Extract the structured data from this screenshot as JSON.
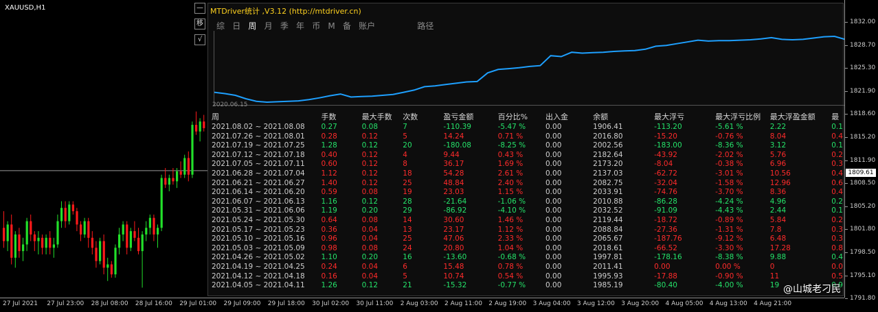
{
  "symbol_title": "XAUUSD,H1",
  "side_buttons": [
    "—",
    "移",
    "√"
  ],
  "panel": {
    "title": "MTDriver统计 ,V3.12 (http://mtdriver.cn)",
    "tabs": [
      "综",
      "日",
      "周",
      "月",
      "季",
      "年",
      "币",
      "M",
      "备",
      "账户",
      "路径"
    ],
    "active_tab": "周",
    "equity_start_date": "2020.06.15",
    "equity_color": "#1ea0ff"
  },
  "table": {
    "headers": [
      "周",
      "手数",
      "最大手数",
      "次数",
      "盈亏金额",
      "百分比%",
      "出入金",
      "余额",
      "最大浮亏",
      "最大浮亏比例",
      "最大浮盈金额",
      "最"
    ],
    "rows": [
      {
        "status": "win",
        "cells": [
          "2021.08.02 ~ 2021.08.08",
          "0.27",
          "0.08",
          "7",
          "-110.39",
          "-5.47 %",
          "0.00",
          "1906.41",
          "-113.20",
          "-5.61 %",
          "2.22",
          "0.1"
        ]
      },
      {
        "status": "loss",
        "cells": [
          "2021.07.26 ~ 2021.08.01",
          "0.28",
          "0.12",
          "5",
          "14.24",
          "0.71 %",
          "0.00",
          "2016.80",
          "-15.20",
          "-0.76 %",
          "8.04",
          "0.4"
        ]
      },
      {
        "status": "win",
        "cells": [
          "2021.07.19 ~ 2021.07.25",
          "1.28",
          "0.12",
          "20",
          "-180.08",
          "-8.25 %",
          "0.00",
          "2002.56",
          "-183.00",
          "-8.36 %",
          "3.12",
          "0.1"
        ]
      },
      {
        "status": "loss",
        "cells": [
          "2021.07.12 ~ 2021.07.18",
          "0.40",
          "0.12",
          "4",
          "9.44",
          "0.43 %",
          "0.00",
          "2182.64",
          "-43.92",
          "-2.02 %",
          "5.76",
          "0.2"
        ]
      },
      {
        "status": "loss",
        "cells": [
          "2021.07.05 ~ 2021.07.11",
          "0.60",
          "0.12",
          "8",
          "36.17",
          "1.69 %",
          "0.00",
          "2173.20",
          "-8.04",
          "-0.38 %",
          "6.96",
          "0.3"
        ]
      },
      {
        "status": "loss",
        "cells": [
          "2021.06.28 ~ 2021.07.04",
          "1.12",
          "0.12",
          "18",
          "54.28",
          "2.61 %",
          "0.00",
          "2137.03",
          "-62.72",
          "-3.01 %",
          "10.56",
          "0.4"
        ]
      },
      {
        "status": "loss",
        "cells": [
          "2021.06.21 ~ 2021.06.27",
          "1.40",
          "0.12",
          "25",
          "48.84",
          "2.40 %",
          "0.00",
          "2082.75",
          "-32.04",
          "-1.58 %",
          "12.96",
          "0.6"
        ]
      },
      {
        "status": "loss",
        "cells": [
          "2021.06.14 ~ 2021.06.20",
          "0.59",
          "0.08",
          "19",
          "23.03",
          "1.15 %",
          "0.00",
          "2033.91",
          "-74.76",
          "-3.70 %",
          "8.36",
          "0.4"
        ]
      },
      {
        "status": "win",
        "cells": [
          "2021.06.07 ~ 2021.06.13",
          "1.16",
          "0.12",
          "28",
          "-21.64",
          "-1.06 %",
          "0.00",
          "2010.88",
          "-86.28",
          "-4.24 %",
          "4.96",
          "0.2"
        ]
      },
      {
        "status": "win",
        "cells": [
          "2021.05.31 ~ 2021.06.06",
          "1.19",
          "0.20",
          "29",
          "-86.92",
          "-4.10 %",
          "0.00",
          "2032.52",
          "-91.09",
          "-4.43 %",
          "2.44",
          "0.1"
        ]
      },
      {
        "status": "loss",
        "cells": [
          "2021.05.24 ~ 2021.05.30",
          "0.64",
          "0.08",
          "14",
          "30.60",
          "1.46 %",
          "0.00",
          "2119.44",
          "-18.72",
          "-0.89 %",
          "5.84",
          "0.2"
        ]
      },
      {
        "status": "loss",
        "cells": [
          "2021.05.17 ~ 2021.05.23",
          "0.36",
          "0.04",
          "13",
          "23.17",
          "1.12 %",
          "0.00",
          "2088.84",
          "-27.36",
          "-1.31 %",
          "7.8",
          "0.3"
        ]
      },
      {
        "status": "loss",
        "cells": [
          "2021.05.10 ~ 2021.05.16",
          "0.96",
          "0.04",
          "25",
          "47.06",
          "2.33 %",
          "0.00",
          "2065.67",
          "-187.76",
          "-9.12 %",
          "6.48",
          "0.3"
        ]
      },
      {
        "status": "loss",
        "cells": [
          "2021.05.03 ~ 2021.05.09",
          "0.98",
          "0.08",
          "24",
          "20.80",
          "1.04 %",
          "0.00",
          "2018.61",
          "-66.52",
          "-3.30 %",
          "17.28",
          "0.8"
        ]
      },
      {
        "status": "win",
        "cells": [
          "2021.04.26 ~ 2021.05.02",
          "1.10",
          "0.20",
          "16",
          "-13.60",
          "-0.68 %",
          "0.00",
          "1997.81",
          "-178.16",
          "-8.38 %",
          "9.88",
          "0.4"
        ]
      },
      {
        "status": "loss",
        "cells": [
          "2021.04.19 ~ 2021.04.25",
          "0.24",
          "0.04",
          "6",
          "15.48",
          "0.78 %",
          "0.00",
          "2011.41",
          "0.00",
          "0.00 %",
          "0",
          "0.0"
        ]
      },
      {
        "status": "loss",
        "cells": [
          "2021.04.12 ~ 2021.04.18",
          "0.16",
          "0.04",
          "5",
          "10.74",
          "0.54 %",
          "0.00",
          "1995.93",
          "-17.88",
          "-0.90 %",
          "11",
          "0.5"
        ]
      },
      {
        "status": "win",
        "cells": [
          "2021.04.05 ~ 2021.04.11",
          "1.26",
          "0.12",
          "21",
          "-15.32",
          "-0.77 %",
          "0.00",
          "1985.19",
          "-80.40",
          "-4.00 %",
          "19",
          "0.9"
        ]
      }
    ]
  },
  "price_axis": {
    "labels": [
      "1832.00",
      "1828.70",
      "1825.30",
      "1821.90",
      "1818.60",
      "1815.20",
      "1811.90",
      "1808.50",
      "1805.20",
      "1801.80",
      "1798.50",
      "1795.10",
      "1791.80"
    ],
    "current_price": "1809.61"
  },
  "time_axis": {
    "labels": [
      "27 Jul 2021",
      "27 Jul 23:00",
      "28 Jul 08:00",
      "28 Jul 16:00",
      "29 Jul 01:00",
      "29 Jul 09:00",
      "29 Jul 18:00",
      "30 Jul 02:00",
      "30 Jul 11:00",
      "2 Aug 03:00",
      "2 Aug 11:00",
      "2 Aug 19:00",
      "3 Aug 04:00",
      "3 Aug 12:00",
      "3 Aug 20:00",
      "4 Aug 05:00",
      "4 Aug 13:00",
      "4 Aug 21:00"
    ]
  },
  "candles": [
    {
      "o": 1801.0,
      "h": 1803.5,
      "l": 1798.0,
      "c": 1799.0
    },
    {
      "o": 1799.0,
      "h": 1802.0,
      "l": 1797.5,
      "c": 1801.5
    },
    {
      "o": 1801.5,
      "h": 1803.0,
      "l": 1795.5,
      "c": 1796.5
    },
    {
      "o": 1796.5,
      "h": 1800.5,
      "l": 1795.0,
      "c": 1800.0
    },
    {
      "o": 1800.0,
      "h": 1801.0,
      "l": 1796.5,
      "c": 1797.5
    },
    {
      "o": 1797.5,
      "h": 1799.5,
      "l": 1796.0,
      "c": 1798.5
    },
    {
      "o": 1798.5,
      "h": 1802.5,
      "l": 1797.5,
      "c": 1802.0
    },
    {
      "o": 1802.0,
      "h": 1803.0,
      "l": 1799.0,
      "c": 1800.0
    },
    {
      "o": 1800.0,
      "h": 1800.5,
      "l": 1797.5,
      "c": 1799.0
    },
    {
      "o": 1799.0,
      "h": 1800.5,
      "l": 1797.0,
      "c": 1799.5
    },
    {
      "o": 1799.5,
      "h": 1800.0,
      "l": 1797.0,
      "c": 1798.0
    },
    {
      "o": 1798.0,
      "h": 1800.0,
      "l": 1797.0,
      "c": 1799.5
    },
    {
      "o": 1799.5,
      "h": 1800.5,
      "l": 1797.0,
      "c": 1798.0
    },
    {
      "o": 1798.0,
      "h": 1799.5,
      "l": 1796.5,
      "c": 1798.5
    },
    {
      "o": 1798.5,
      "h": 1803.0,
      "l": 1798.0,
      "c": 1802.0
    },
    {
      "o": 1802.0,
      "h": 1805.0,
      "l": 1801.0,
      "c": 1804.0
    },
    {
      "o": 1804.0,
      "h": 1805.0,
      "l": 1801.0,
      "c": 1802.0
    },
    {
      "o": 1802.0,
      "h": 1805.0,
      "l": 1801.5,
      "c": 1804.5
    },
    {
      "o": 1804.5,
      "h": 1805.0,
      "l": 1803.0,
      "c": 1803.5
    },
    {
      "o": 1803.5,
      "h": 1804.0,
      "l": 1800.5,
      "c": 1801.5
    },
    {
      "o": 1801.5,
      "h": 1802.0,
      "l": 1799.0,
      "c": 1800.0
    },
    {
      "o": 1800.0,
      "h": 1802.5,
      "l": 1799.5,
      "c": 1802.0
    },
    {
      "o": 1802.0,
      "h": 1802.5,
      "l": 1798.0,
      "c": 1799.5
    },
    {
      "o": 1799.5,
      "h": 1800.5,
      "l": 1797.0,
      "c": 1798.0
    },
    {
      "o": 1798.0,
      "h": 1799.0,
      "l": 1795.0,
      "c": 1796.0
    },
    {
      "o": 1796.0,
      "h": 1799.5,
      "l": 1795.5,
      "c": 1799.0
    },
    {
      "o": 1799.0,
      "h": 1800.0,
      "l": 1794.0,
      "c": 1795.0
    },
    {
      "o": 1795.0,
      "h": 1796.5,
      "l": 1793.0,
      "c": 1795.5
    },
    {
      "o": 1795.5,
      "h": 1796.0,
      "l": 1793.5,
      "c": 1794.0
    },
    {
      "o": 1794.0,
      "h": 1798.5,
      "l": 1793.5,
      "c": 1798.0
    },
    {
      "o": 1798.0,
      "h": 1801.0,
      "l": 1797.0,
      "c": 1800.0
    },
    {
      "o": 1800.0,
      "h": 1802.0,
      "l": 1799.0,
      "c": 1801.5
    },
    {
      "o": 1801.5,
      "h": 1802.0,
      "l": 1797.0,
      "c": 1798.0
    },
    {
      "o": 1798.0,
      "h": 1801.0,
      "l": 1797.5,
      "c": 1800.5
    },
    {
      "o": 1800.5,
      "h": 1802.0,
      "l": 1799.0,
      "c": 1799.5
    },
    {
      "o": 1799.5,
      "h": 1801.0,
      "l": 1797.0,
      "c": 1797.5
    },
    {
      "o": 1797.5,
      "h": 1800.5,
      "l": 1792.0,
      "c": 1800.0
    },
    {
      "o": 1800.0,
      "h": 1802.0,
      "l": 1799.0,
      "c": 1801.0
    },
    {
      "o": 1801.0,
      "h": 1803.0,
      "l": 1800.0,
      "c": 1802.5
    },
    {
      "o": 1802.5,
      "h": 1803.0,
      "l": 1799.0,
      "c": 1800.0
    },
    {
      "o": 1800.0,
      "h": 1801.5,
      "l": 1798.0,
      "c": 1801.0
    },
    {
      "o": 1801.0,
      "h": 1809.0,
      "l": 1800.5,
      "c": 1808.5
    },
    {
      "o": 1808.5,
      "h": 1810.0,
      "l": 1807.0,
      "c": 1807.5
    },
    {
      "o": 1807.5,
      "h": 1809.0,
      "l": 1806.5,
      "c": 1808.5
    },
    {
      "o": 1808.5,
      "h": 1810.0,
      "l": 1807.5,
      "c": 1808.0
    },
    {
      "o": 1808.0,
      "h": 1810.0,
      "l": 1807.0,
      "c": 1809.5
    },
    {
      "o": 1809.5,
      "h": 1811.0,
      "l": 1808.5,
      "c": 1809.0
    },
    {
      "o": 1809.0,
      "h": 1812.0,
      "l": 1808.5,
      "c": 1811.5
    },
    {
      "o": 1811.5,
      "h": 1812.5,
      "l": 1808.0,
      "c": 1809.0
    },
    {
      "o": 1809.0,
      "h": 1817.0,
      "l": 1808.5,
      "c": 1816.5
    },
    {
      "o": 1816.5,
      "h": 1818.5,
      "l": 1815.0,
      "c": 1815.5
    },
    {
      "o": 1815.5,
      "h": 1817.5,
      "l": 1814.0,
      "c": 1817.0
    },
    {
      "o": 1817.0,
      "h": 1818.0,
      "l": 1815.5,
      "c": 1816.0
    }
  ],
  "equity_curve": [
    1975,
    1972,
    1968,
    1960,
    1954,
    1952,
    1953,
    1954,
    1955,
    1958,
    1962,
    1967,
    1971,
    1964,
    1965,
    1966,
    1968,
    1970,
    1975,
    1980,
    1988,
    1990,
    1993,
    1996,
    1999,
    2000,
    2020,
    2028,
    2030,
    2032,
    2035,
    2037,
    2060,
    2058,
    2068,
    2066,
    2067,
    2068,
    2070,
    2071,
    2072,
    2075,
    2082,
    2084,
    2088,
    2092,
    2096,
    2094,
    2095,
    2095,
    2096,
    2097,
    2099,
    2102,
    2098,
    2097,
    2098,
    2101,
    2104,
    2105,
    2098
  ]
}
